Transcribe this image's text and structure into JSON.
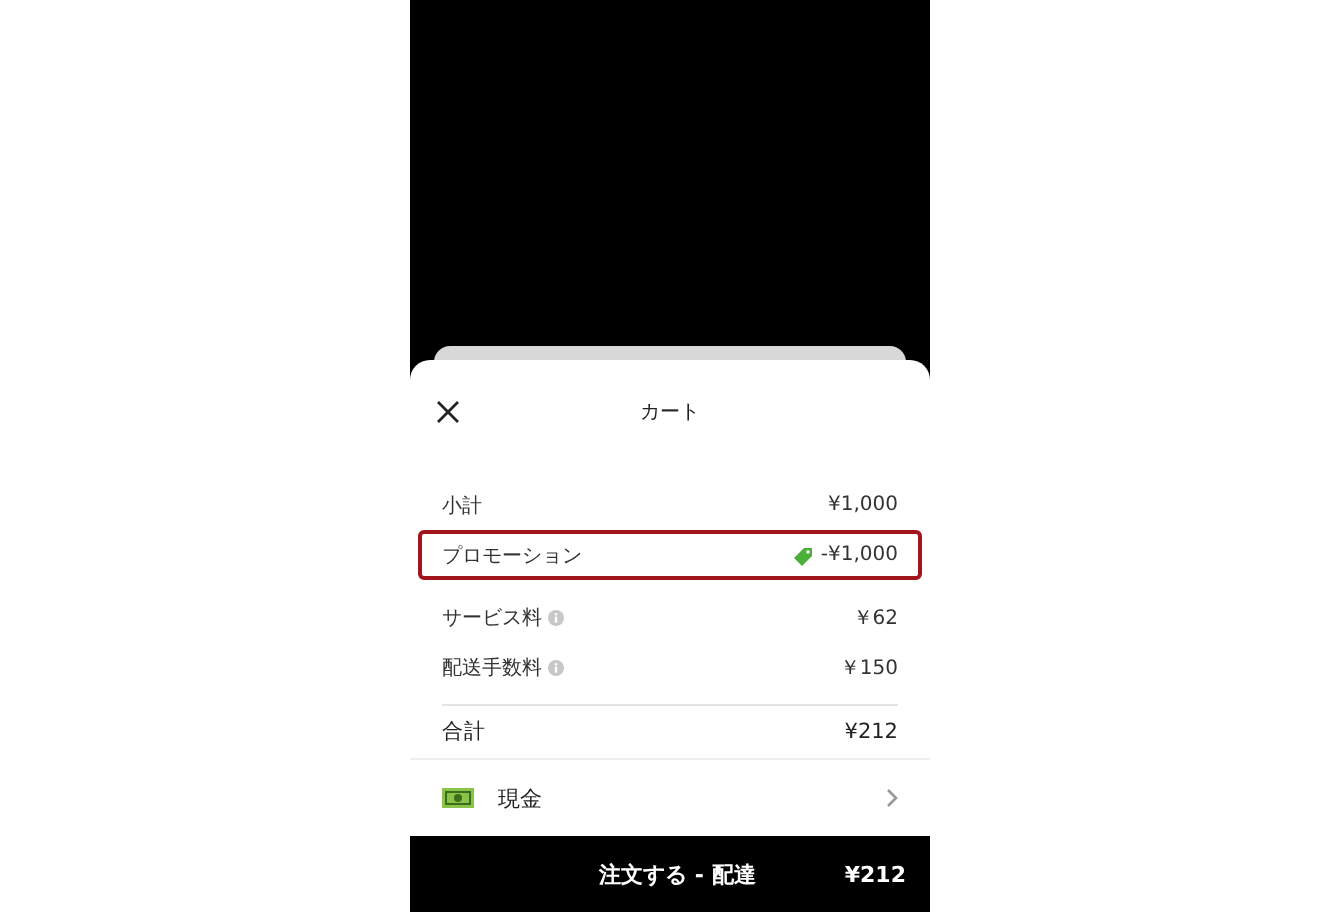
{
  "sheet": {
    "title": "カート"
  },
  "lines": [
    {
      "kind": "plain",
      "label": "小計",
      "amount": "¥1,000",
      "highlighted": false
    },
    {
      "kind": "promo",
      "label": "プロモーション",
      "amount": "-¥1,000",
      "highlighted": true
    },
    {
      "kind": "fee",
      "label": "サービス料",
      "amount": "￥62",
      "highlighted": false
    },
    {
      "kind": "fee",
      "label": "配送手数料",
      "amount": "￥150",
      "highlighted": false
    }
  ],
  "total": {
    "label": "合計",
    "amount": "¥212"
  },
  "payment": {
    "label": "現金"
  },
  "order_button": {
    "label": "注文する - 配達",
    "amount": "¥212"
  }
}
